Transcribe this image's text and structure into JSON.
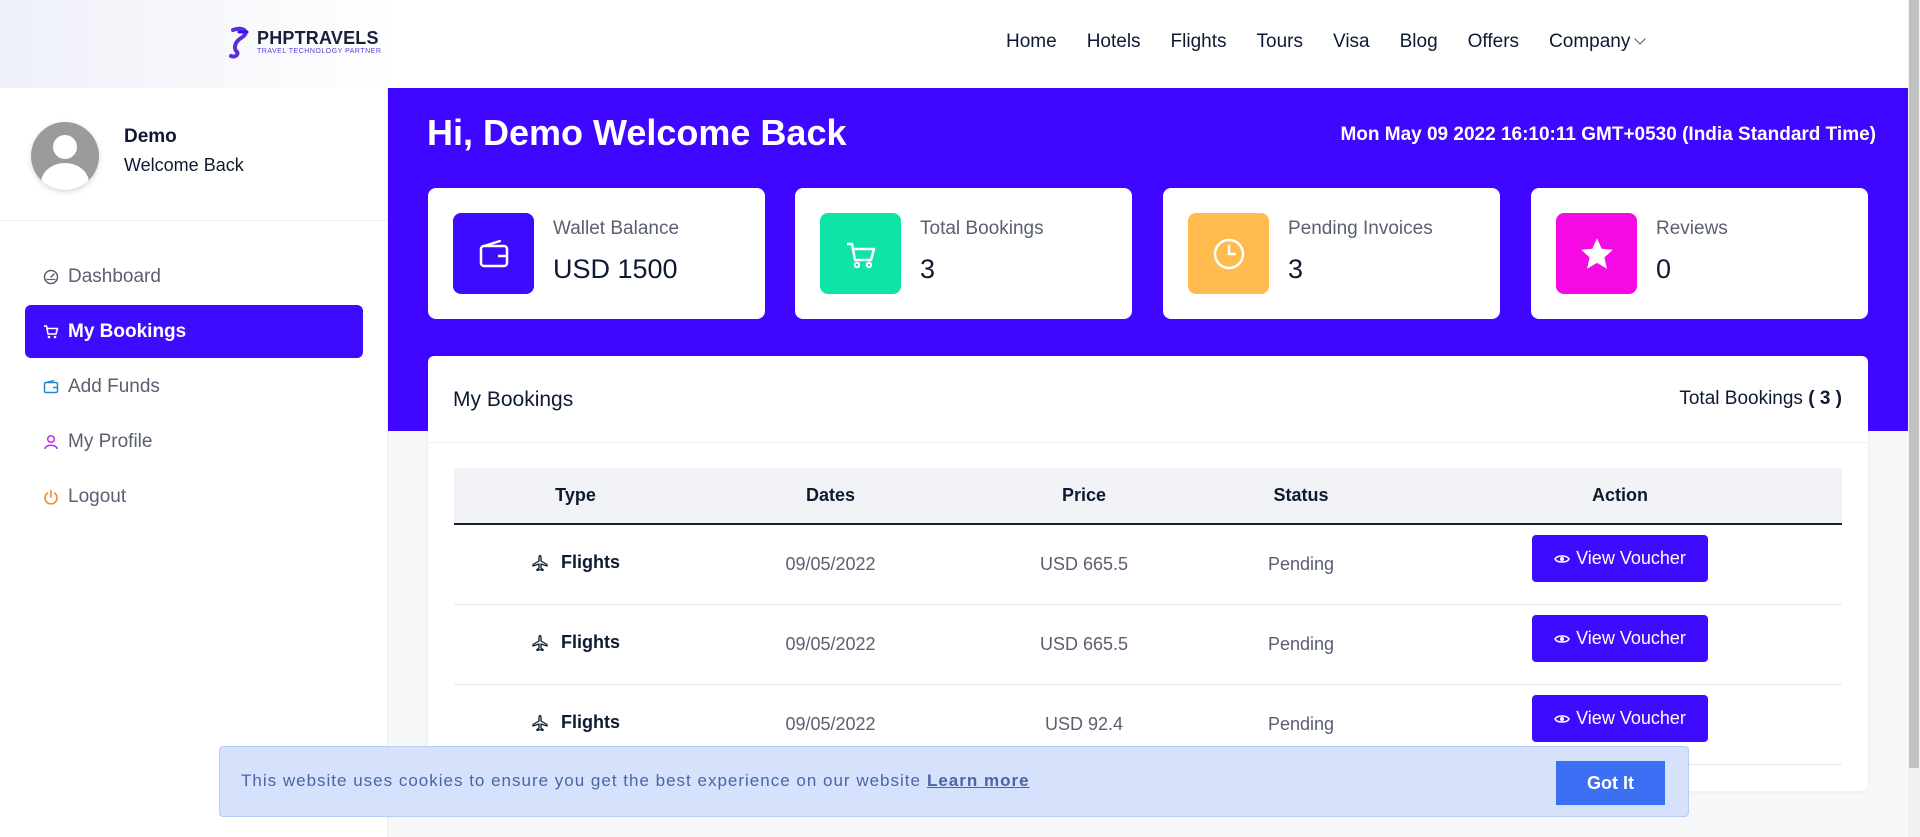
{
  "header": {
    "logo_title": "PHPTRAVELS",
    "logo_subtitle": "TRAVEL TECHNOLOGY PARTNER",
    "nav": [
      "Home",
      "Hotels",
      "Flights",
      "Tours",
      "Visa",
      "Blog",
      "Offers",
      "Company"
    ]
  },
  "sidebar": {
    "user_name": "Demo",
    "user_greeting": "Welcome Back",
    "items": [
      {
        "label": "Dashboard",
        "icon": "dashboard-icon",
        "active": false
      },
      {
        "label": "My Bookings",
        "icon": "cart-icon",
        "active": true
      },
      {
        "label": "Add Funds",
        "icon": "wallet-icon",
        "active": false
      },
      {
        "label": "My Profile",
        "icon": "user-icon",
        "active": false
      },
      {
        "label": "Logout",
        "icon": "power-icon",
        "active": false
      }
    ]
  },
  "hero": {
    "title": "Hi, Demo Welcome Back",
    "datetime": "Mon May 09 2022 16:10:11 GMT+0530 (India Standard Time)"
  },
  "stats": [
    {
      "label": "Wallet Balance",
      "value": "USD 1500",
      "color": "#3d0cff",
      "icon": "wallet-icon"
    },
    {
      "label": "Total Bookings",
      "value": "3",
      "color": "#0fe3a6",
      "icon": "cart-icon"
    },
    {
      "label": "Pending Invoices",
      "value": "3",
      "color": "#ffbb4d",
      "icon": "clock-icon"
    },
    {
      "label": "Reviews",
      "value": "0",
      "color": "#f50ae4",
      "icon": "star-icon"
    }
  ],
  "bookings": {
    "title": "My Bookings",
    "total_label": "Total Bookings",
    "total_value": "( 3 )",
    "columns": [
      "Type",
      "Dates",
      "Price",
      "Status",
      "Action"
    ],
    "rows": [
      {
        "type": "Flights",
        "date": "09/05/2022",
        "price": "USD 665.5",
        "status": "Pending",
        "action": "View Voucher"
      },
      {
        "type": "Flights",
        "date": "09/05/2022",
        "price": "USD 665.5",
        "status": "Pending",
        "action": "View Voucher"
      },
      {
        "type": "Flights",
        "date": "09/05/2022",
        "price": "USD 92.4",
        "status": "Pending",
        "action": "View Voucher"
      }
    ]
  },
  "cookie": {
    "text": "This website uses cookies to ensure you get the best experience on our website",
    "learn_more": "Learn more",
    "button": "Got It"
  },
  "colors": {
    "primary": "#3d0cff",
    "hero_bg": "#3f07ff",
    "cookie_bg": "#d6e2fb",
    "cookie_button": "#3d6ff5"
  }
}
